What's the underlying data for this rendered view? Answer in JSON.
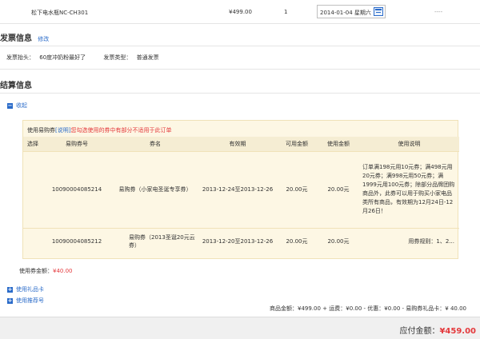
{
  "product": {
    "name": "松下电水瓶NC-CH301",
    "price": "¥499.00",
    "qty": "1",
    "date": "2014-01-04 星期六",
    "dash": "----"
  },
  "invoice": {
    "title": "发票信息",
    "edit": "修改",
    "head_label": "发票抬头：",
    "head_value": "60度冲奶粉最好了",
    "type_label": "发票类型：",
    "type_value": "普通发票"
  },
  "settle": {
    "title": "结算信息",
    "collapse": "收起",
    "coupon_heading_pre": "使用易购券",
    "coupon_heading_link": "[说明]",
    "coupon_heading_note": "您勾选使用的券中有部分不适用于此订单",
    "columns": [
      "选择",
      "易购券号",
      "券名",
      "有效期",
      "可用金额",
      "使用金额",
      "使用说明"
    ],
    "rows": [
      {
        "code": "10090004085214",
        "name": "易购券（小家电圣诞专享券）",
        "period": "2013-12-24至2013-12-26",
        "available": "20.00元",
        "used": "20.00元",
        "desc": "订单满198元用10元券；满498元用20元券；满998元用50元券；满1999元用100元券；除部分品牌团购商品外，此券可以用于购买小家电品类所有商品，有效期为12月24日-12月26日！"
      },
      {
        "code": "10090004085212",
        "name": "易购券（2013圣诞20元云券）",
        "period": "2013-12-20至2013-12-26",
        "available": "20.00元",
        "used": "20.00元",
        "desc": "用券规则：1、2..."
      }
    ],
    "coupon_total_label": "使用券金额：",
    "coupon_total_value": "¥40.00",
    "gift_card": "使用礼品卡",
    "referral": "使用推荐号"
  },
  "summary": {
    "line": "商品金额：¥499.00 + 运费：¥0.00 - 优惠：¥0.00 - 易购券礼品卡：¥ 40.00",
    "payable_label": "应付金额：",
    "payable_value": "¥459.00"
  },
  "colors": {
    "link": "#2a6bc9",
    "price_red": "#e4393c",
    "panel_bg": "#fdf7e4"
  }
}
